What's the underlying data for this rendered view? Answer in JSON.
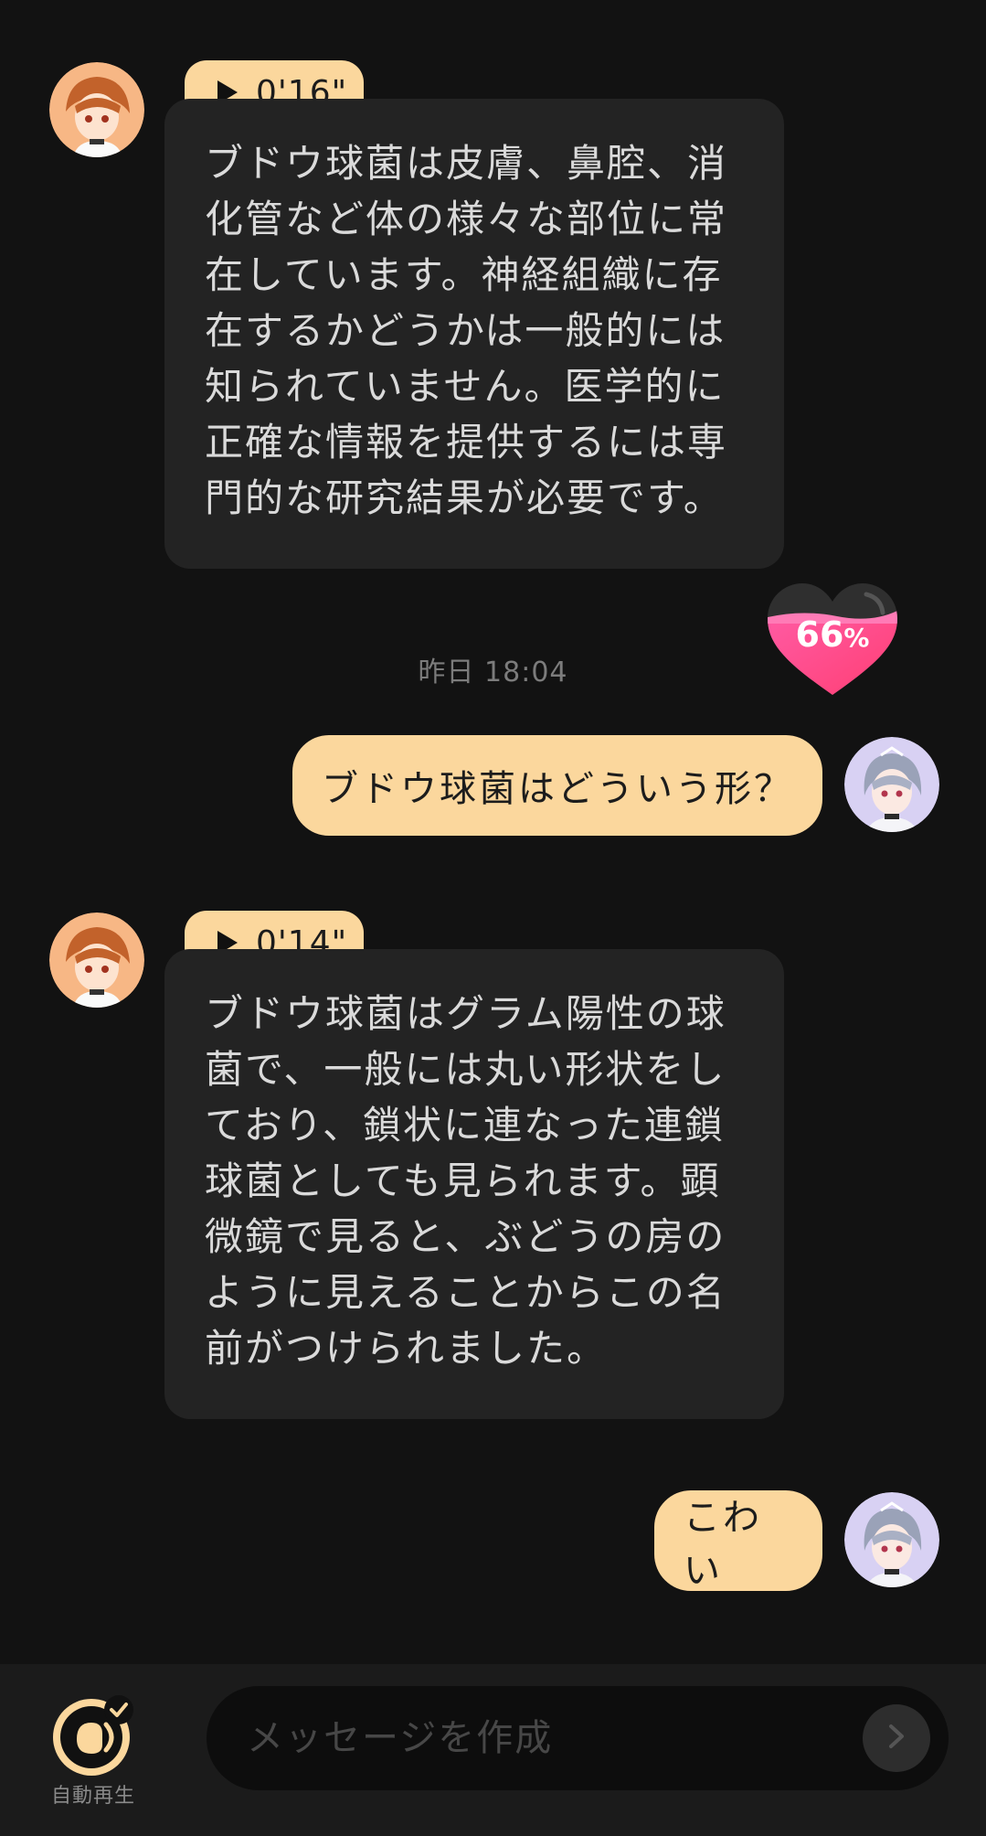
{
  "messages": [
    {
      "role": "assistant",
      "voice_duration": "0'16\"",
      "text": "ブドウ球菌は皮膚、鼻腔、消化管など体の様々な部位に常在しています。神経組織に存在するかどうかは一般的には知られていません。医学的に正確な情報を提供するには専門的な研究結果が必要です。"
    },
    {
      "role": "timestamp",
      "text": "昨日  18:04"
    },
    {
      "role": "user",
      "text": "ブドウ球菌はどういう形？"
    },
    {
      "role": "assistant",
      "voice_duration": "0'14\"",
      "text": "ブドウ球菌はグラム陽性の球菌で、一般には丸い形状をしており、鎖状に連なった連鎖球菌としても見られます。顕微鏡で見ると、ぶどうの房のように見えることからこの名前がつけられました。"
    },
    {
      "role": "user",
      "text": "こわい"
    }
  ],
  "affection": {
    "value": "66",
    "unit": "%",
    "level": 0.66
  },
  "composer": {
    "placeholder": "メッセージを作成",
    "autoplay_label": "自動再生"
  },
  "colors": {
    "background": "#121212",
    "bot_bubble": "#232323",
    "user_bubble": "#fbd79d",
    "heart": "#ff4f8f"
  },
  "icons": [
    "play-icon",
    "heart-icon",
    "autoplay-icon",
    "chevron-right-icon",
    "bot-avatar",
    "user-avatar"
  ]
}
